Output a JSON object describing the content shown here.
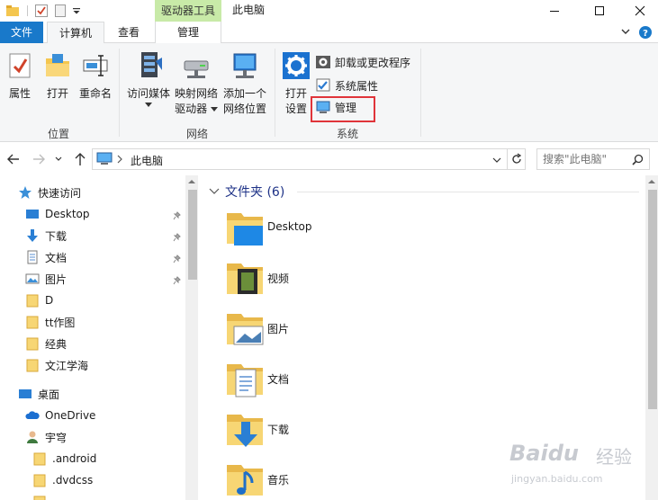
{
  "window": {
    "context_tab": "驱动器工具",
    "title": "此电脑"
  },
  "ribbon_tabs": {
    "file": "文件",
    "computer": "计算机",
    "view": "查看",
    "manage": "管理"
  },
  "ribbon": {
    "location_group": {
      "label": "位置",
      "properties": "属性",
      "open": "打开",
      "rename": "重命名"
    },
    "network_group": {
      "label": "网络",
      "access_media": "访问媒体",
      "map_drive_line1": "映射网络",
      "map_drive_line2": "驱动器",
      "add_location_line1": "添加一个",
      "add_location_line2": "网络位置"
    },
    "system_group": {
      "label": "系统",
      "open_settings_line1": "打开",
      "open_settings_line2": "设置",
      "uninstall": "卸载或更改程序",
      "system_properties": "系统属性",
      "manage": "管理"
    }
  },
  "address_bar": {
    "path": "此电脑",
    "search_placeholder": "搜索\"此电脑\""
  },
  "nav_pane": {
    "quick_access": "快速访问",
    "items": [
      {
        "label": "Desktop"
      },
      {
        "label": "下载"
      },
      {
        "label": "文档"
      },
      {
        "label": "图片"
      },
      {
        "label": "D"
      },
      {
        "label": "tt作图"
      },
      {
        "label": "经典"
      },
      {
        "label": "文江学海"
      }
    ],
    "desktop": "桌面",
    "onedrive": "OneDrive",
    "user": "宇穹",
    "user_folders": [
      {
        "label": ".android"
      },
      {
        "label": ".dvdcss"
      }
    ]
  },
  "content": {
    "section_title": "文件夹 (6)",
    "folders": [
      {
        "label": "Desktop"
      },
      {
        "label": "视频"
      },
      {
        "label": "图片"
      },
      {
        "label": "文档"
      },
      {
        "label": "下载"
      },
      {
        "label": "音乐"
      }
    ]
  },
  "watermark": {
    "brand": "Baidu",
    "brand_cn": "经验",
    "url": "jingyan.baidu.com"
  },
  "colors": {
    "file_tab": "#1979ca",
    "context_tab": "#c8eaa8",
    "highlight": "#e0343a",
    "section_title": "#1e3287",
    "folder_yellow": "#f7d674"
  }
}
